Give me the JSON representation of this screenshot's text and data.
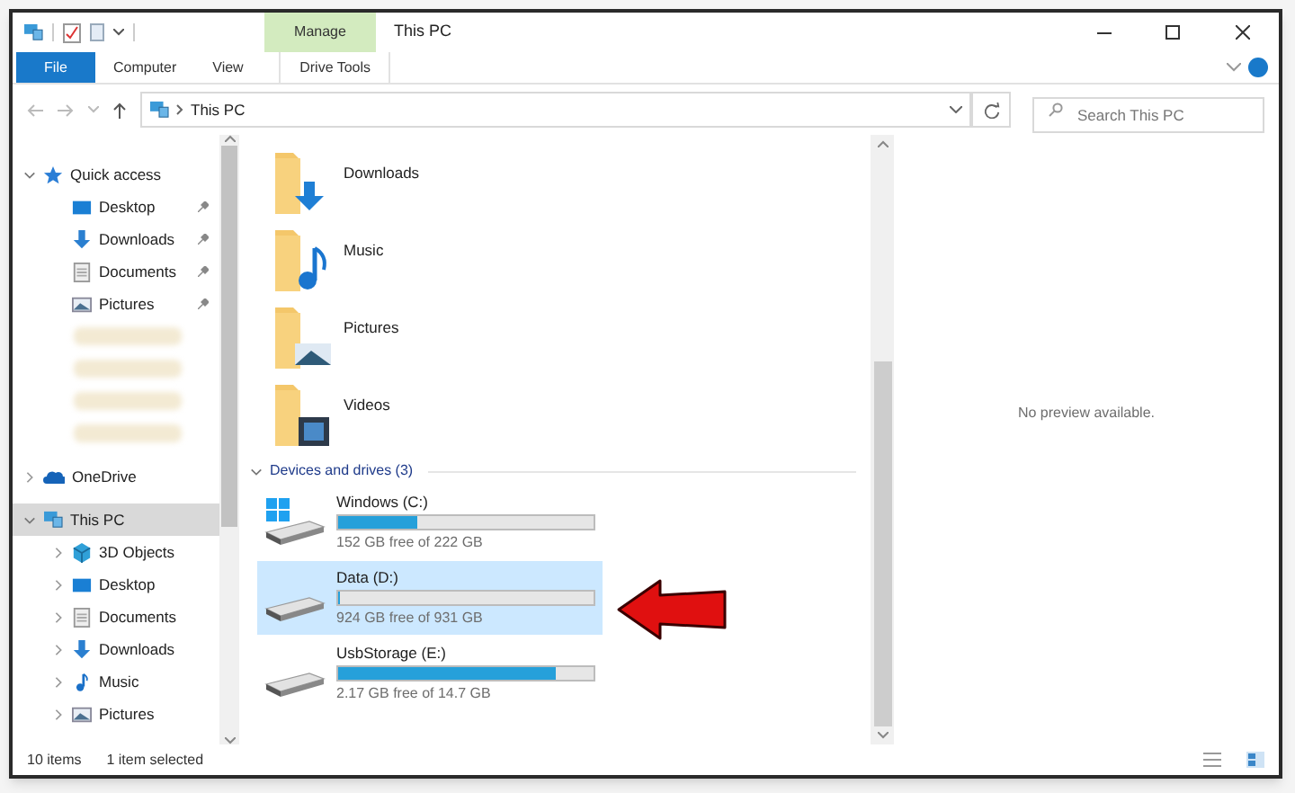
{
  "window": {
    "title": "This PC",
    "context_tab": "Manage"
  },
  "ribbon_tabs": [
    {
      "label": "File",
      "selected": false,
      "kind": "file"
    },
    {
      "label": "Computer",
      "selected": false,
      "kind": "tab"
    },
    {
      "label": "View",
      "selected": false,
      "kind": "tab"
    },
    {
      "label": "Drive Tools",
      "selected": false,
      "kind": "tab"
    }
  ],
  "address_bar": {
    "path": "This PC"
  },
  "search": {
    "placeholder": "Search This PC"
  },
  "sidebar": {
    "items": [
      {
        "label": "Quick access",
        "expanded": true,
        "selected": false,
        "children": [
          {
            "label": "Desktop",
            "pinned": true,
            "kind": "item"
          },
          {
            "label": "Downloads",
            "pinned": true,
            "kind": "item"
          },
          {
            "label": "Documents",
            "pinned": true,
            "kind": "item"
          },
          {
            "label": "Pictures",
            "pinned": true,
            "kind": "item"
          },
          {
            "kind": "blurred"
          },
          {
            "kind": "blurred"
          },
          {
            "kind": "blurred"
          },
          {
            "kind": "blurred"
          }
        ]
      },
      {
        "label": "OneDrive",
        "expanded": false,
        "selected": false
      },
      {
        "label": "This PC",
        "expanded": true,
        "selected": true,
        "children": [
          {
            "label": "3D Objects",
            "pinned": false,
            "kind": "item"
          },
          {
            "label": "Desktop",
            "pinned": false,
            "kind": "item"
          },
          {
            "label": "Documents",
            "pinned": false,
            "kind": "item"
          },
          {
            "label": "Downloads",
            "pinned": false,
            "kind": "item"
          },
          {
            "label": "Music",
            "pinned": false,
            "kind": "item"
          },
          {
            "label": "Pictures",
            "pinned": false,
            "kind": "item"
          }
        ]
      }
    ]
  },
  "folders": [
    {
      "name": "Downloads"
    },
    {
      "name": "Music"
    },
    {
      "name": "Pictures"
    },
    {
      "name": "Videos"
    }
  ],
  "drives_group": {
    "label": "Devices and drives (3)",
    "expanded": true
  },
  "drives": [
    {
      "name": "Windows (C:)",
      "level": 0.31,
      "reading": "152 GB free of 222 GB",
      "selected": false
    },
    {
      "name": "Data (D:)",
      "level": 0.008,
      "reading": "924 GB free of 931 GB",
      "selected": true
    },
    {
      "name": "UsbStorage (E:)",
      "level": 0.85,
      "reading": "2.17 GB free of 14.7 GB",
      "selected": false
    }
  ],
  "preview": {
    "message": "No preview available."
  },
  "status_bar": {
    "items_count": "10 items",
    "selection": "1 item selected"
  }
}
